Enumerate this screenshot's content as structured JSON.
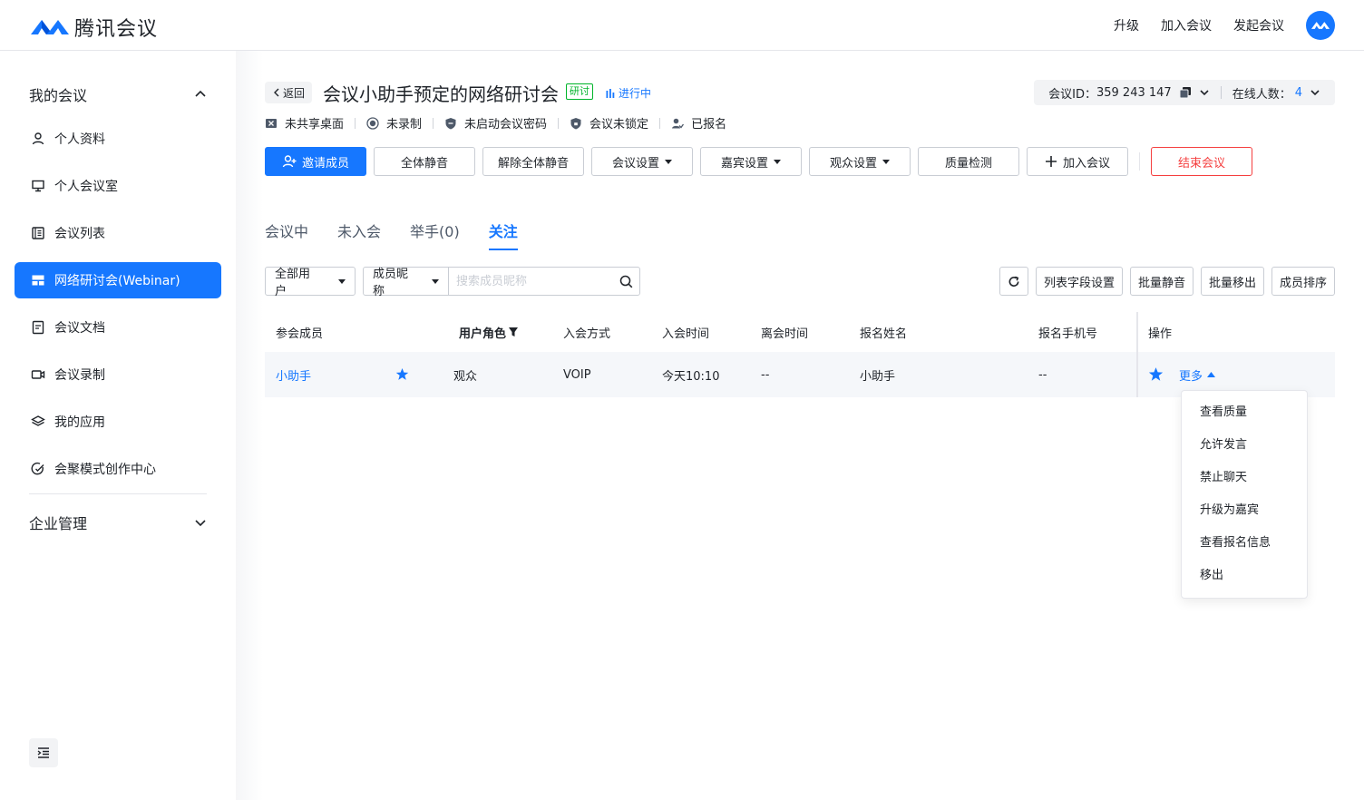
{
  "brand": {
    "name": "腾讯会议",
    "color": "#1677ff"
  },
  "top_nav": [
    "升级",
    "加入会议",
    "发起会议"
  ],
  "sidebar": {
    "my_meetings": "我的会议",
    "items": [
      {
        "label": "个人资料",
        "icon": "user-icon"
      },
      {
        "label": "个人会议室",
        "icon": "monitor-icon"
      },
      {
        "label": "会议列表",
        "icon": "list-icon"
      },
      {
        "label": "网络研讨会(Webinar)",
        "icon": "webinar-icon",
        "active": true
      },
      {
        "label": "会议文档",
        "icon": "document-icon"
      },
      {
        "label": "会议录制",
        "icon": "video-icon"
      },
      {
        "label": "我的应用",
        "icon": "layers-icon"
      },
      {
        "label": "会聚模式创作中心",
        "icon": "creation-icon"
      }
    ],
    "enterprise": "企业管理"
  },
  "header": {
    "back_label": "返回",
    "title": "会议小助手预定的网络研讨会",
    "tag": "研讨",
    "status": "进行中",
    "meeting_id_label": "会议ID：",
    "meeting_id": "359 243 147",
    "online_label": "在线人数：",
    "online_count": "4"
  },
  "states": [
    "未共享桌面",
    "未录制",
    "未启动会议密码",
    "会议未锁定",
    "已报名"
  ],
  "toolbar": {
    "invite": "邀请成员",
    "mute_all": "全体静音",
    "unmute_all": "解除全体静音",
    "meeting_settings": "会议设置",
    "guest_settings": "嘉宾设置",
    "audience_settings": "观众设置",
    "quality": "质量检测",
    "join": "加入会议",
    "end": "结束会议"
  },
  "tabs": [
    "会议中",
    "未入会",
    "举手(0)",
    "关注"
  ],
  "filters": {
    "user_filter": "全部用户",
    "search_field": "成员昵称",
    "search_placeholder": "搜索成员昵称"
  },
  "right_actions": [
    "列表字段设置",
    "批量静音",
    "批量移出",
    "成员排序"
  ],
  "table": {
    "columns": [
      "参会成员",
      "用户角色",
      "入会方式",
      "入会时间",
      "离会时间",
      "报名姓名",
      "报名手机号",
      "操作"
    ],
    "rows": [
      {
        "member": "小助手",
        "role": "观众",
        "join_method": "VOIP",
        "join_time": "今天10:10",
        "leave_time": "--",
        "reg_name": "小助手",
        "reg_phone": "--",
        "more": "更多"
      }
    ]
  },
  "dropdown": [
    "查看质量",
    "允许发言",
    "禁止聊天",
    "升级为嘉宾",
    "查看报名信息",
    "移出"
  ]
}
